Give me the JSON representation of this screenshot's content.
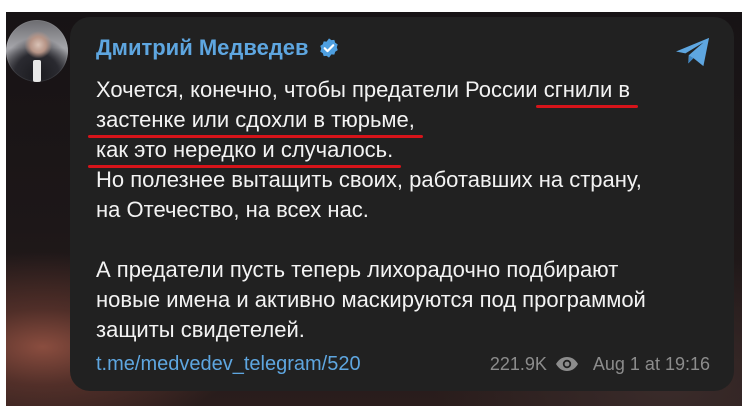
{
  "post": {
    "author": "Дмитрий Медведев",
    "message_lines": [
      [
        "Хочется, конечно, чтобы предатели России ",
        "сгнили в"
      ],
      [
        "застенке или сдохли в тюрьме,"
      ],
      [
        "как это нередко и случалось."
      ],
      [
        "Но полезнее вытащить своих, работавших на страну,"
      ],
      [
        "на Отечество, на всех нас."
      ],
      [
        "А предатели пусть теперь лихорадочно подбирают"
      ],
      [
        "новые имена и активно маскируются под программой"
      ],
      [
        "защиты свидетелей."
      ]
    ],
    "link": "t.me/medvedev_telegram/520",
    "views": "221.9K",
    "date": "Aug 1 at 19:16"
  },
  "icons": {
    "verified": "verified-badge-icon",
    "share": "telegram-share-icon",
    "views": "eye-icon",
    "avatar": "author-avatar"
  },
  "colors": {
    "bubble_bg": "#212121",
    "author_name": "#5ea6e0",
    "link": "#5ea6e0",
    "meta_text": "#8c8c8c",
    "underline": "#d6141a",
    "message_text": "#f3f3f3"
  }
}
